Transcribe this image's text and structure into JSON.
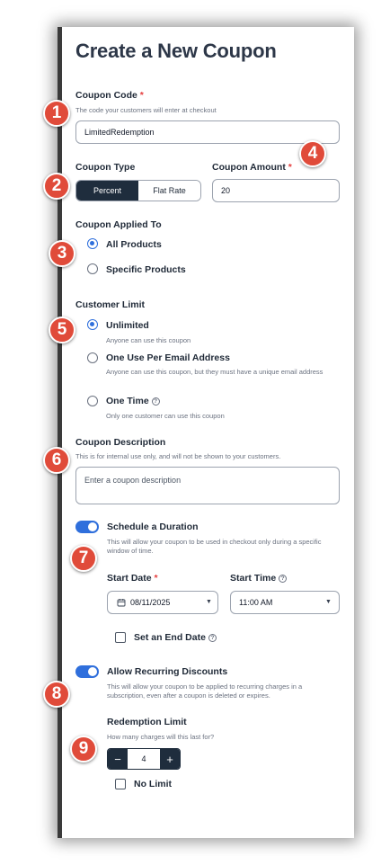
{
  "form": {
    "title": "Create a New Coupon",
    "required_mark": "*",
    "coupon_code": {
      "label": "Coupon Code",
      "help": "The code your customers will enter at checkout",
      "value": "LimitedRedemption"
    },
    "coupon_type": {
      "label": "Coupon Type",
      "options": [
        "Percent",
        "Flat Rate"
      ],
      "selected": "Percent"
    },
    "coupon_amount": {
      "label": "Coupon Amount",
      "value": "20"
    },
    "applied_to": {
      "label": "Coupon Applied To",
      "options": [
        "All Products",
        "Specific Products"
      ],
      "selected": "All Products"
    },
    "customer_limit": {
      "label": "Customer Limit",
      "options": [
        {
          "label": "Unlimited",
          "help": "Anyone can use this coupon"
        },
        {
          "label": "One Use Per Email Address",
          "help": "Anyone can use this coupon, but they must have a unique email address"
        },
        {
          "label": "One Time",
          "help": "Only one customer can use this coupon"
        }
      ],
      "selected": "Unlimited"
    },
    "description": {
      "label": "Coupon Description",
      "help": "This is for internal use only, and will not be shown to your customers.",
      "placeholder": "Enter a coupon description"
    },
    "schedule": {
      "label": "Schedule a Duration",
      "enabled": true,
      "help": "This will allow your coupon to be used in checkout only during a specific window of time.",
      "start_date_label": "Start Date",
      "start_date": "08/11/2025",
      "start_time_label": "Start Time",
      "start_time": "11:00 AM",
      "end_date_label": "Set an End Date",
      "end_date_checked": false
    },
    "recurring": {
      "label": "Allow Recurring Discounts",
      "enabled": true,
      "help": "This will allow your coupon to be applied to recurring charges in a subscription, even after a coupon is deleted or expires."
    },
    "redemption": {
      "label": "Redemption Limit",
      "help": "How many charges will this last for?",
      "value": "4",
      "minus": "−",
      "plus": "+",
      "no_limit_label": "No Limit",
      "no_limit_checked": false
    }
  },
  "annotations": [
    "1",
    "2",
    "3",
    "4",
    "5",
    "6",
    "7",
    "8",
    "9"
  ],
  "colors": {
    "accent": "#2f6fdc",
    "dark": "#1f2d3d",
    "badge": "#e04b3a",
    "required": "#e53e3e"
  }
}
